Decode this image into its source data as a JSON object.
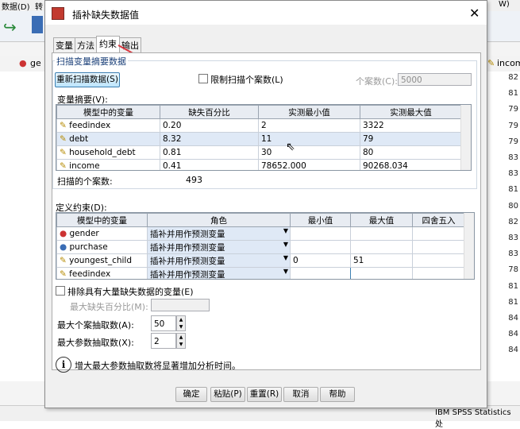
{
  "background_app": {
    "menu": {
      "item_1": "数据(D)",
      "item_2": "转",
      "item_3": "W)"
    },
    "col_left_label": "ge",
    "col_right_label": "incom",
    "right_values": [
      "82",
      "81",
      "79",
      "79",
      "79",
      "83",
      "83",
      "81",
      "80",
      "82",
      "83",
      "83",
      "78",
      "81",
      "81",
      "84",
      "84",
      "84"
    ],
    "status_text": "IBM SPSS Statistics 处"
  },
  "dialog": {
    "title": "插补缺失数据值",
    "tabs": [
      {
        "label": "变量"
      },
      {
        "label": "方法"
      },
      {
        "label": "约束"
      },
      {
        "label": "输出"
      }
    ],
    "scan_group": {
      "title": "扫描变量摘要数据",
      "rescan_button": "重新扫描数据(S)",
      "limit_label": "限制扫描个案数(L)",
      "cases_label": "个案数(C):",
      "cases_value": "5000",
      "summary_label": "变量摘要(V):",
      "summary_headers": [
        "模型中的变量",
        "缺失百分比",
        "实测最小值",
        "实测最大值"
      ],
      "summary_rows": [
        {
          "var": "feedindex",
          "missing": "0.20",
          "min": "2",
          "max": "3322"
        },
        {
          "var": "debt",
          "missing": "8.32",
          "min": "11",
          "max": "79"
        },
        {
          "var": "household_debt",
          "missing": "0.81",
          "min": "30",
          "max": "80"
        },
        {
          "var": "income",
          "missing": "0.41",
          "min": "78652.000",
          "max": "90268.034"
        }
      ],
      "scanned_label": "扫描的个案数:",
      "scanned_value": "493"
    },
    "constraints": {
      "label": "定义约束(D):",
      "headers": [
        "模型中的变量",
        "角色",
        "最小值",
        "最大值",
        "四舍五入"
      ],
      "rows": [
        {
          "var": "gender",
          "role": "插补并用作预测变量",
          "min": "",
          "max": "",
          "round": ""
        },
        {
          "var": "purchase",
          "role": "插补并用作预测变量",
          "min": "",
          "max": "",
          "round": ""
        },
        {
          "var": "youngest_child",
          "role": "插补并用作预测变量",
          "min": "0",
          "max": "51",
          "round": ""
        },
        {
          "var": "feedindex",
          "role": "插补并用作预测变量",
          "min": "",
          "max": "",
          "round": ""
        }
      ]
    },
    "exclude_label": "排除具有大量缺失数据的变量(E)",
    "max_missing_label": "最大缺失百分比(M):",
    "max_case_draws_label": "最大个案抽取数(A):",
    "max_case_draws_value": "50",
    "max_param_draws_label": "最大参数抽取数(X):",
    "max_param_draws_value": "2",
    "info_text": "增大最大参数抽取数将显著增加分析时间。",
    "buttons": {
      "ok": "确定",
      "paste": "粘贴(P)",
      "reset": "重置(R)",
      "cancel": "取消",
      "help": "帮助"
    },
    "accent_color": "#d9363e"
  }
}
